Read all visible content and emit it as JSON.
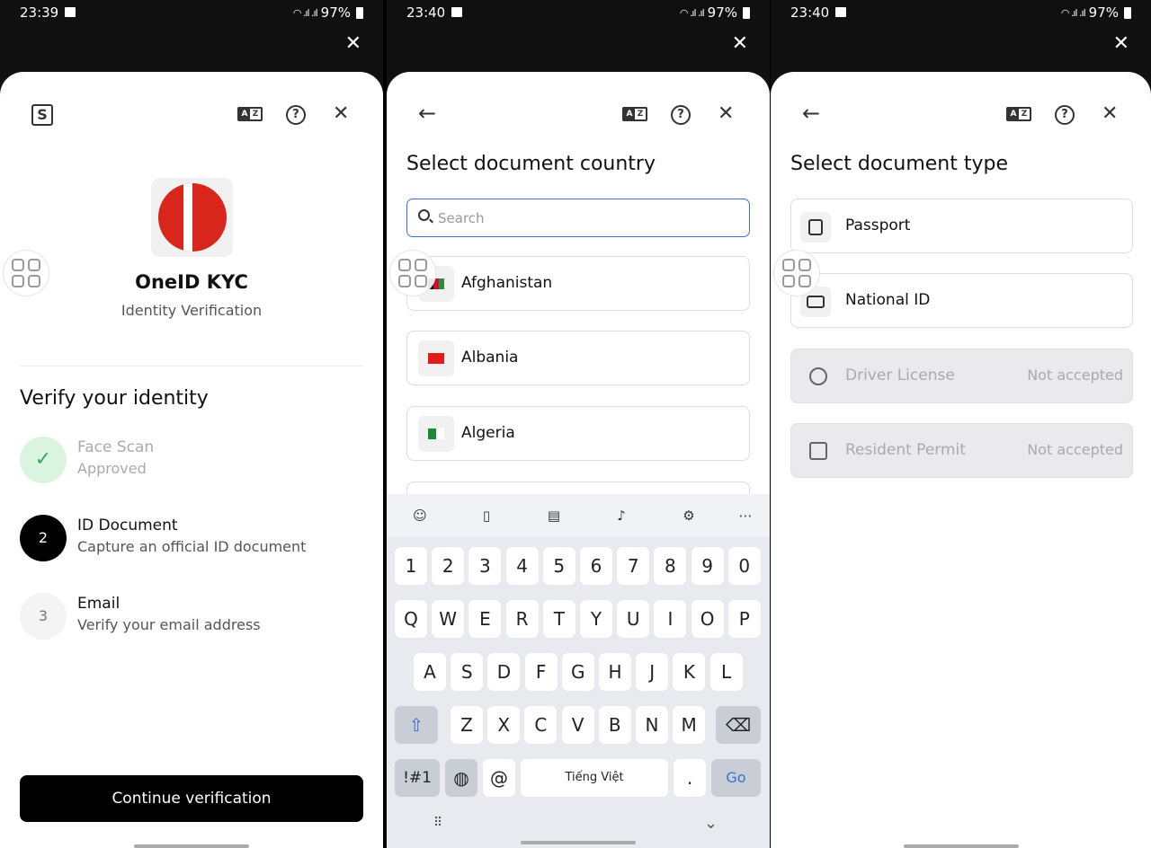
{
  "screens": [
    {
      "status": {
        "time": "23:39",
        "battery": "97%"
      },
      "app_name": "OneID KYC",
      "app_subtitle": "Identity Verification",
      "heading": "Verify your identity",
      "steps": [
        {
          "icon": "check-icon",
          "title": "Face Scan",
          "subtitle": "Approved",
          "state": "done"
        },
        {
          "number": "2",
          "title": "ID Document",
          "subtitle": "Capture an official ID document",
          "state": "active"
        },
        {
          "number": "3",
          "title": "Email",
          "subtitle": "Verify your email address",
          "state": "pending"
        }
      ],
      "cta": "Continue verification"
    },
    {
      "status": {
        "time": "23:40",
        "battery": "97%"
      },
      "heading": "Select document country",
      "search_placeholder": "Search",
      "countries": [
        {
          "name": "Afghanistan"
        },
        {
          "name": "Albania"
        },
        {
          "name": "Algeria"
        }
      ],
      "keyboard": {
        "number_row": [
          "1",
          "2",
          "3",
          "4",
          "5",
          "6",
          "7",
          "8",
          "9",
          "0"
        ],
        "row1": [
          "Q",
          "W",
          "E",
          "R",
          "T",
          "Y",
          "U",
          "I",
          "O",
          "P"
        ],
        "row2": [
          "A",
          "S",
          "D",
          "F",
          "G",
          "H",
          "J",
          "K",
          "L"
        ],
        "row3": [
          "Z",
          "X",
          "C",
          "V",
          "B",
          "N",
          "M"
        ],
        "symbols_label": "!#1",
        "at_label": "@",
        "space_label": "Tiếng Việt",
        "period_label": ".",
        "go_label": "Go"
      }
    },
    {
      "status": {
        "time": "23:40",
        "battery": "97%"
      },
      "heading": "Select document type",
      "documents": [
        {
          "name": "Passport",
          "accepted": true
        },
        {
          "name": "National ID",
          "accepted": true
        },
        {
          "name": "Driver License",
          "accepted": false,
          "note": "Not accepted"
        },
        {
          "name": "Resident Permit",
          "accepted": false,
          "note": "Not accepted"
        }
      ]
    }
  ],
  "colors": {
    "brand_red": "#d9261c",
    "approved_green": "#d9f5df",
    "focus_blue": "#3b6fd6"
  }
}
